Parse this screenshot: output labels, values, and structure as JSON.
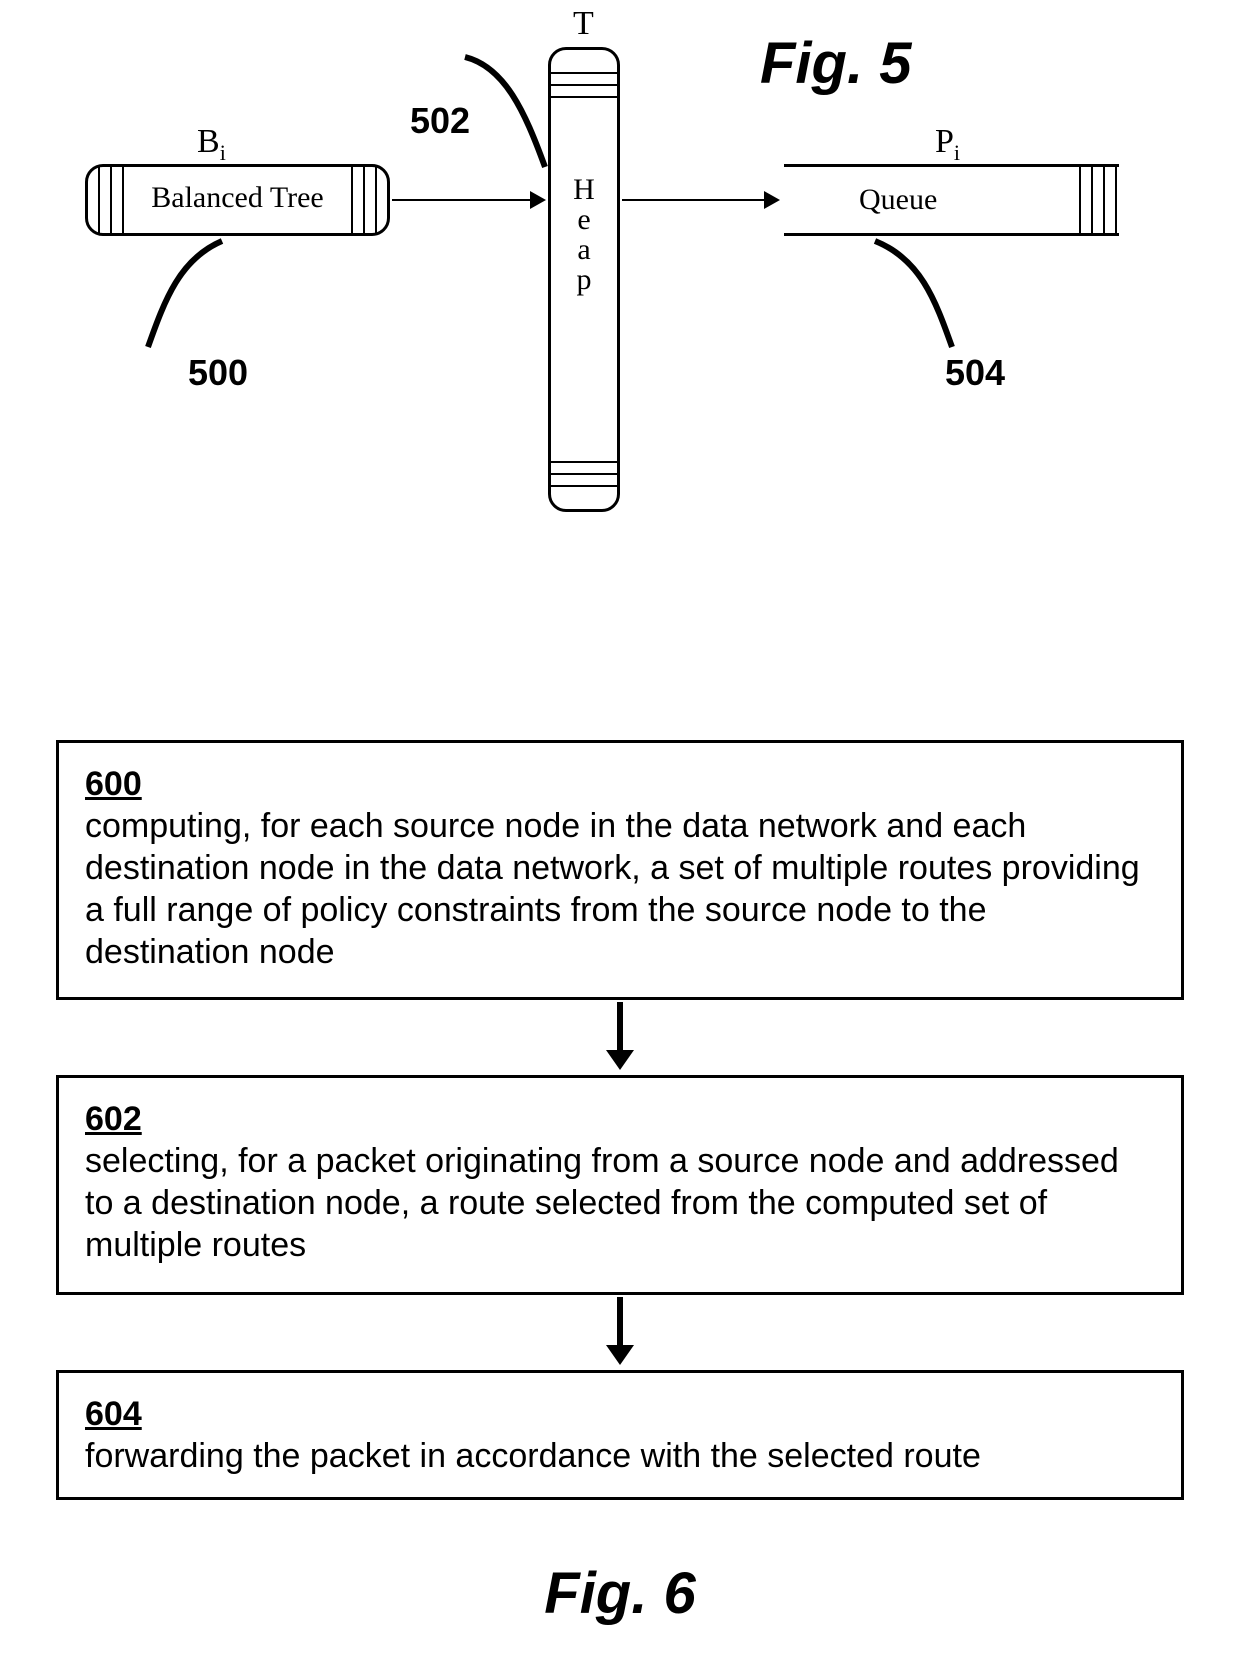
{
  "fig5": {
    "title": "Fig. 5",
    "balanced_tree": {
      "label": "B",
      "label_sub": "i",
      "text": "Balanced Tree",
      "ref": "500"
    },
    "heap": {
      "label": "T",
      "text_chars": [
        "H",
        "e",
        "a",
        "p"
      ],
      "ref": "502"
    },
    "queue": {
      "label": "P",
      "label_sub": "i",
      "text": "Queue",
      "ref": "504"
    }
  },
  "fig6": {
    "title": "Fig. 6",
    "steps": [
      {
        "ref": "600",
        "text": "computing, for each source node in the data network and each destination node in the data network, a set of  multiple routes providing a full range of policy constraints from the source node to the destination node"
      },
      {
        "ref": "602",
        "text": "selecting, for a packet originating from a source node and addressed to a destination node, a route selected from the computed set of multiple routes"
      },
      {
        "ref": "604",
        "text": "forwarding the packet in accordance with the selected route"
      }
    ]
  }
}
